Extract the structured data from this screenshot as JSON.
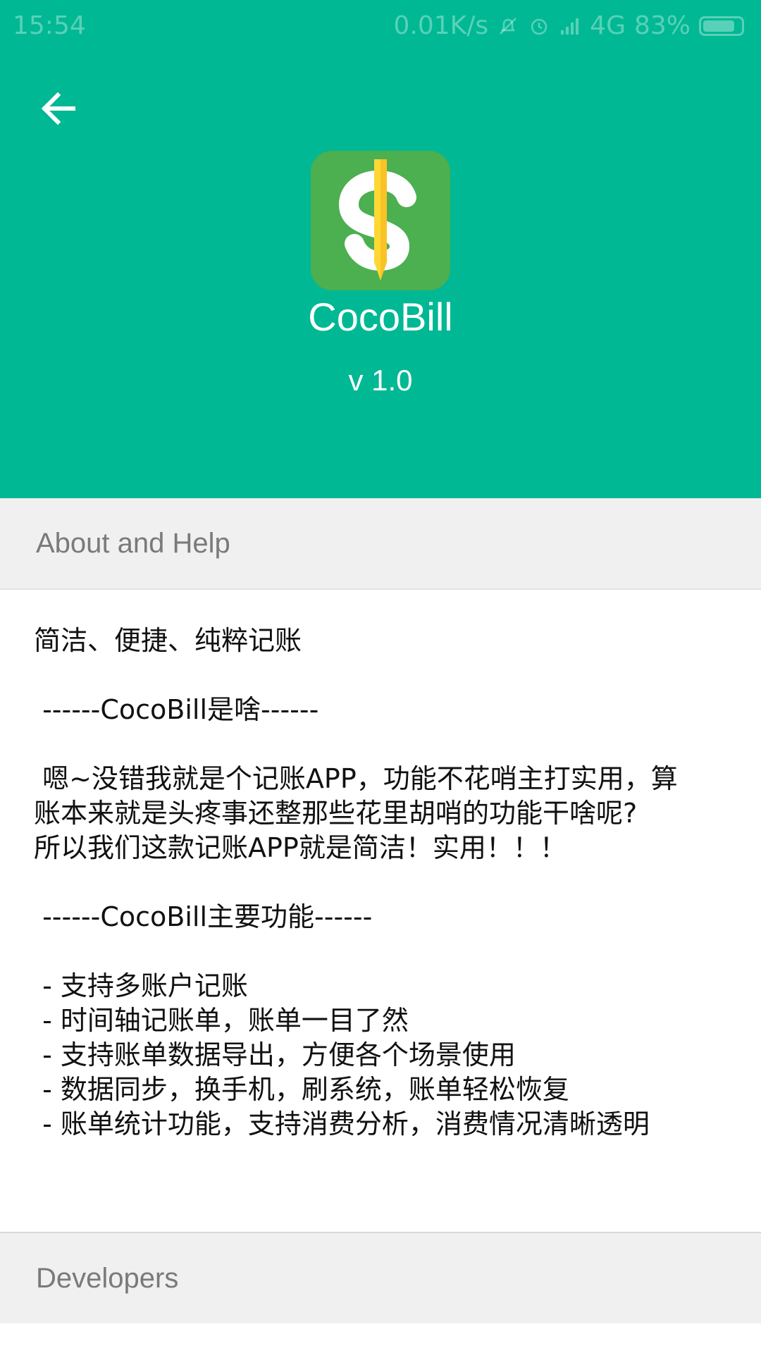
{
  "status_bar": {
    "time": "15:54",
    "net_speed": "0.01K/s",
    "network": "4G",
    "battery": "83%"
  },
  "header": {
    "app_name": "CocoBill",
    "version": "v 1.0",
    "background_color": "#00b894"
  },
  "sections": {
    "about_title": "About and Help",
    "developers_title": "Developers"
  },
  "about": {
    "tagline": "简洁、便捷、纯粹记账",
    "what_heading": " ------CocoBill是啥------",
    "desc_1": " 嗯~没错我就是个记账APP，功能不花哨主打实用，算",
    "desc_2": "账本来就是头疼事还整那些花里胡哨的功能干啥呢?",
    "desc_3": "所以我们这款记账APP就是简洁！实用！！！",
    "features_heading": " ------CocoBill主要功能------",
    "features": [
      " - 支持多账户记账",
      " - 时间轴记账单，账单一目了然",
      " - 支持账单数据导出，方便各个场景使用",
      " - 数据同步，换手机，刷系统，账单轻松恢复",
      " - 账单统计功能，支持消费分析，消费情况清晰透明"
    ]
  },
  "icons": {
    "back": "arrow-left",
    "logo": "dollar-pencil"
  }
}
